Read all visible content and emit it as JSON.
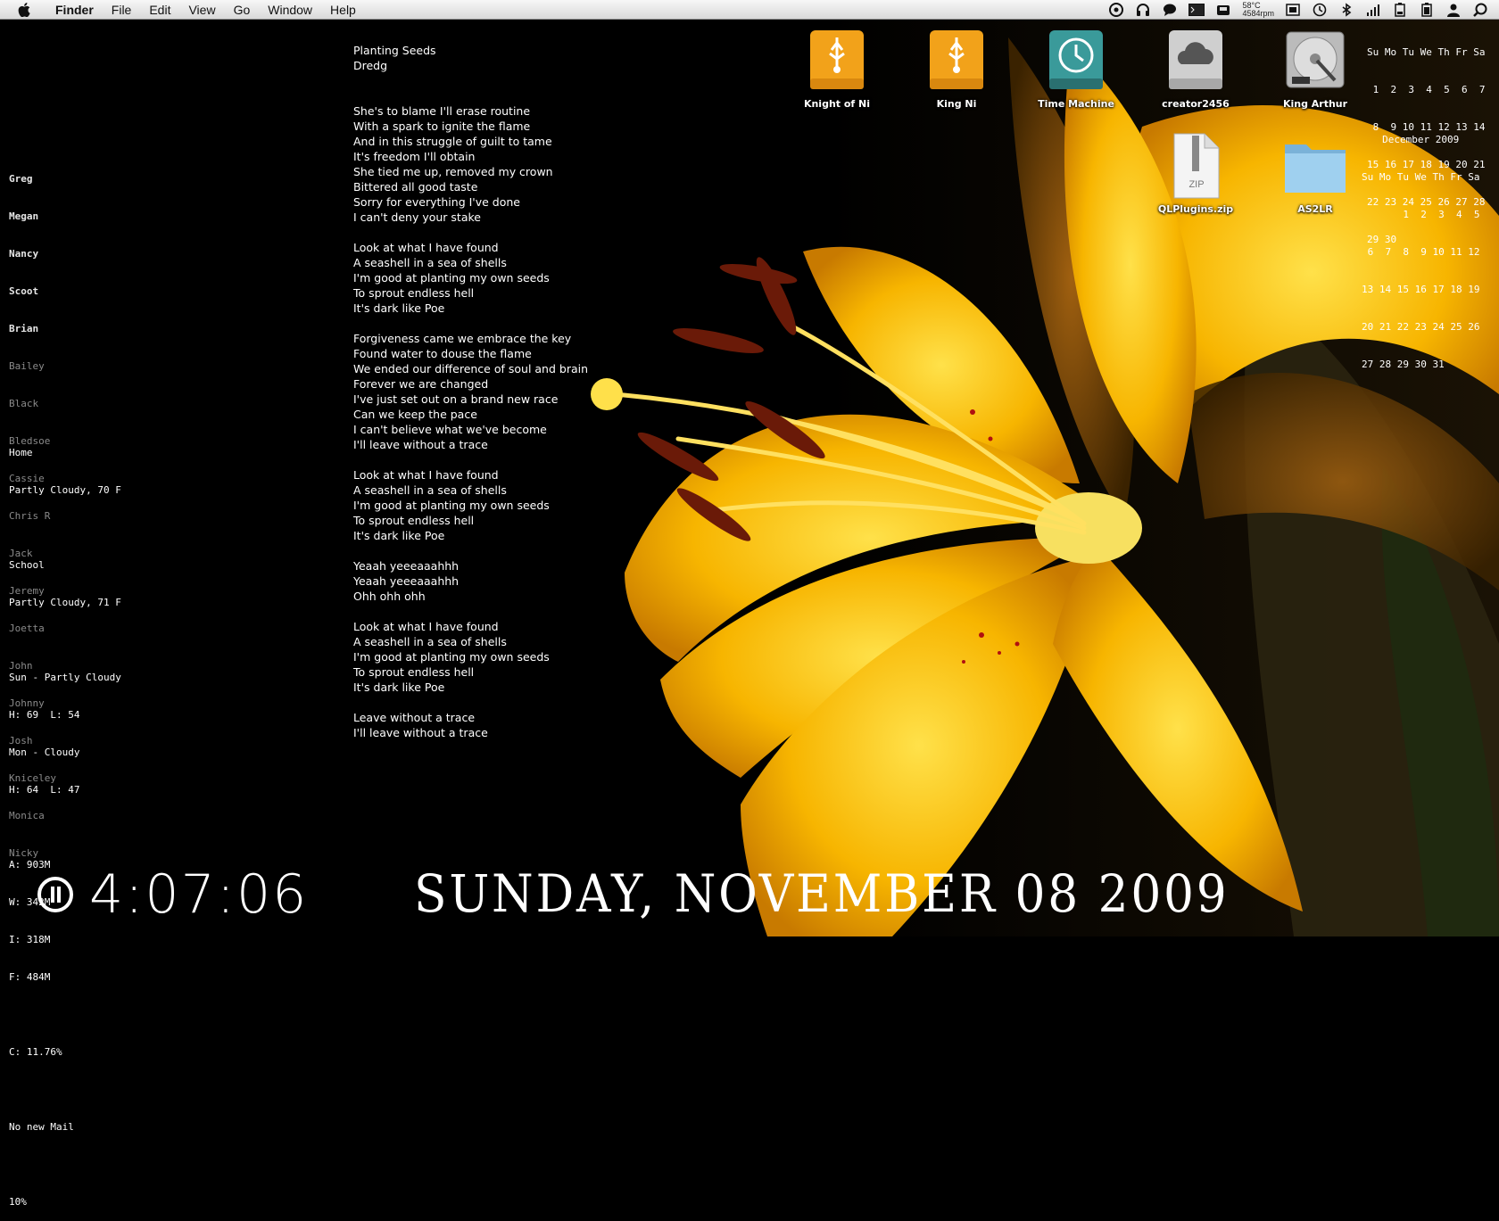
{
  "menubar": {
    "app": "Finder",
    "menus": [
      "File",
      "Edit",
      "View",
      "Go",
      "Window",
      "Help"
    ],
    "temp": "58°C",
    "rpm": "4584rpm",
    "status_icons": [
      "activity-icon",
      "headphones-icon",
      "chat-icon",
      "terminal-icon",
      "drive-icon",
      "display-icon",
      "timemachine-icon",
      "bluetooth-icon",
      "signal-icon",
      "battery-icon",
      "battery-icon-2",
      "user-icon",
      "spotlight-icon"
    ]
  },
  "people": {
    "active": [
      "Greg",
      "Megan",
      "Nancy",
      "Scoot",
      "Brian"
    ],
    "inactive": [
      "Bailey",
      "Black",
      "Bledsoe",
      "Cassie",
      "Chris R",
      "Jack",
      "Jeremy",
      "Joetta",
      "John",
      "Johnny",
      "Josh",
      "Kniceley",
      "Monica",
      "Nicky"
    ]
  },
  "weather": {
    "home_label": "Home",
    "home_cond": "Partly Cloudy, 70 F",
    "school_label": "School",
    "school_cond": "Partly Cloudy, 71 F",
    "fc1": "Sun - Partly Cloudy",
    "fc1_hl": "H: 69  L: 54",
    "fc2": "Mon - Cloudy",
    "fc2_hl": "H: 64  L: 47"
  },
  "memory": {
    "a": "A: 903M",
    "w": "W: 342M",
    "i": "I: 318M",
    "f": "F: 484M"
  },
  "cpu": "C: 11.76%",
  "mail": "No new Mail",
  "battery_pct": "10%",
  "song": {
    "title": "Planting Seeds",
    "artist": "Dredg",
    "stanzas": [
      [
        "She's to blame I'll erase routine",
        "With a spark to ignite the flame",
        "And in this struggle of guilt to tame",
        "It's freedom I'll obtain",
        "She tied me up, removed my crown",
        "Bittered all good taste",
        "Sorry for everything I've done",
        "I can't deny your stake"
      ],
      [
        "Look at what I have found",
        "A seashell in a sea of shells",
        "I'm good at planting my own seeds",
        "To sprout endless hell",
        "It's dark like Poe"
      ],
      [
        "Forgiveness came we embrace the key",
        "Found water to douse the flame",
        "We ended our difference of soul and brain",
        "Forever we are changed",
        "I've just set out on a brand new race",
        "Can we keep the pace",
        "I can't believe what we've become",
        "I'll leave without a trace"
      ],
      [
        "Look at what I have found",
        "A seashell in a sea of shells",
        "I'm good at planting my own seeds",
        "To sprout endless hell",
        "It's dark like Poe"
      ],
      [
        "Yeaah yeeeaaahhh",
        "Yeaah yeeeaaahhh",
        "Ohh ohh ohh"
      ],
      [
        "Look at what I have found",
        "A seashell in a sea of shells",
        "I'm good at planting my own seeds",
        "To sprout endless hell",
        "It's dark like Poe"
      ],
      [
        "Leave without a trace",
        "I'll leave without a trace"
      ]
    ]
  },
  "desktop_icons": [
    {
      "label": "Knight of Ni"
    },
    {
      "label": "King Ni"
    },
    {
      "label": "Time Machine"
    },
    {
      "label": "creator2456"
    },
    {
      "label": "King Arthur"
    },
    {
      "label": "QLPlugins.zip",
      "badge": "ZIP"
    },
    {
      "label": "AS2LR"
    }
  ],
  "cal_nov": {
    "header": "Su Mo Tu We Th Fr Sa",
    "rows": [
      " 1  2  3  4  5  6  7",
      " 8  9 10 11 12 13 14",
      "15 16 17 18 19 20 21",
      "22 23 24 25 26 27 28",
      "29 30"
    ]
  },
  "cal_dec": {
    "title": "December 2009",
    "header": "Su Mo Tu We Th Fr Sa",
    "rows": [
      "       1  2  3  4  5",
      " 6  7  8  9 10 11 12",
      "13 14 15 16 17 18 19",
      "20 21 22 23 24 25 26",
      "27 28 29 30 31"
    ]
  },
  "clock": "4:07:06",
  "date": "SUNDAY, NOVEMBER 08 2009",
  "colors": {
    "usb_orange": "#f2a21a",
    "tm_teal": "#3a9a9a",
    "folder_blue": "#8cc4e8",
    "menubar": "#e8e8e8"
  }
}
